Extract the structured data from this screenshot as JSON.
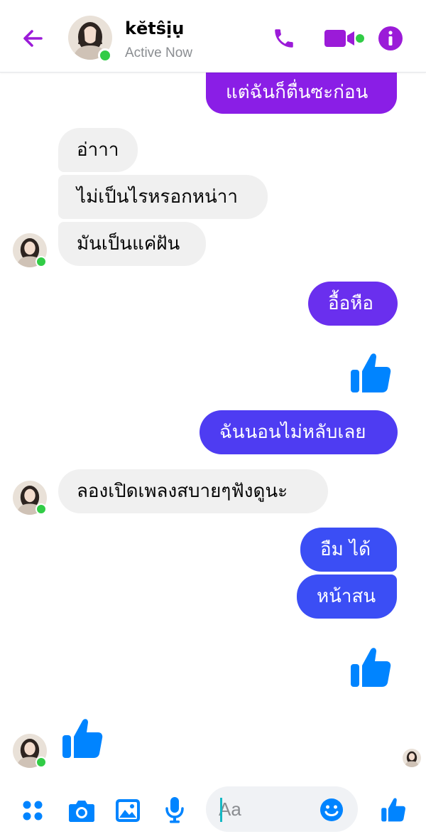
{
  "header": {
    "back_icon": "arrow-left-icon",
    "contact_name": "kĕtŝịụ",
    "status": "Active Now",
    "call_icon": "phone-icon",
    "video_icon": "video-camera-icon",
    "info_icon": "info-icon",
    "accent_color": "#9b1bd8"
  },
  "messages": [
    {
      "from": "me",
      "text": "แต่ฉันก็ตื่นซะก่อน"
    },
    {
      "from": "them",
      "text": "อ่าาา"
    },
    {
      "from": "them",
      "text": "ไม่เป็นไรหรอกหน่าา"
    },
    {
      "from": "them",
      "text": "มันเป็นแค่ฝัน"
    },
    {
      "from": "me",
      "text": "อื้อหือ"
    },
    {
      "from": "me",
      "type": "like"
    },
    {
      "from": "me",
      "text": "ฉันนอนไม่หลับเลย"
    },
    {
      "from": "them",
      "text": "ลองเปิดเพลงสบายๆฟังดูนะ"
    },
    {
      "from": "me",
      "text": "อืม ได้"
    },
    {
      "from": "me",
      "text": "หน้าสน"
    },
    {
      "from": "me",
      "type": "like"
    },
    {
      "from": "them",
      "type": "like"
    }
  ],
  "composer": {
    "placeholder": "Aa",
    "menu_icon": "four-dots-icon",
    "camera_icon": "camera-icon",
    "gallery_icon": "image-icon",
    "mic_icon": "microphone-icon",
    "emoji_icon": "smiley-icon",
    "like_icon": "thumbs-up-icon",
    "icon_color": "#0084ff"
  }
}
